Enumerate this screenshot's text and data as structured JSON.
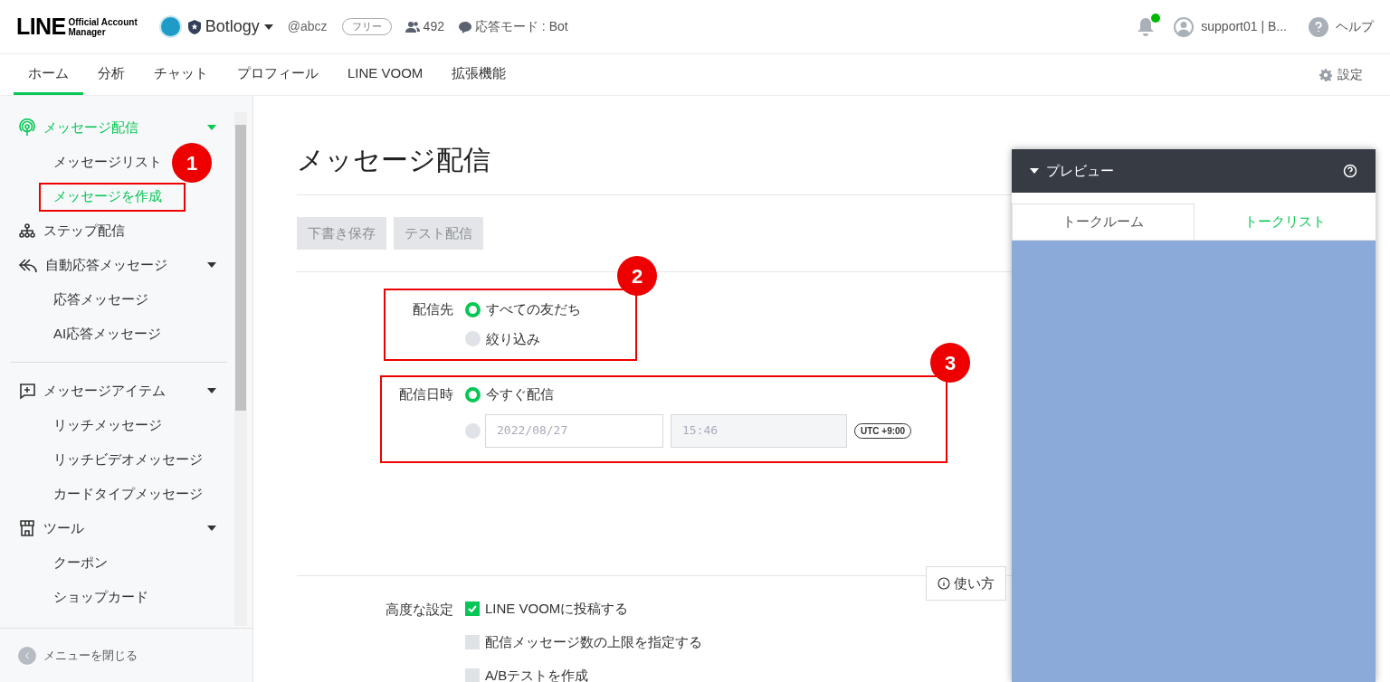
{
  "header": {
    "logo": {
      "wordmark": "LINE",
      "subtitle_1": "Official Account",
      "subtitle_2": "Manager"
    },
    "account": {
      "name": "Botlogy",
      "handle": "@abcz",
      "plan": "フリー",
      "friends": "492",
      "mode": "応答モード : Bot"
    },
    "notifications": {
      "unread": true
    },
    "user": "support01 | B...",
    "help": "ヘルプ"
  },
  "nav": {
    "tabs": [
      {
        "label": "ホーム",
        "selected": true
      },
      {
        "label": "分析",
        "selected": false
      },
      {
        "label": "チャット",
        "selected": false
      },
      {
        "label": "プロフィール",
        "selected": false
      },
      {
        "label": "LINE VOOM",
        "selected": false
      },
      {
        "label": "拡張機能",
        "selected": false
      }
    ],
    "settings": "設定"
  },
  "sidebar": {
    "sections": [
      [
        {
          "label": "メッセージ配信",
          "selected": true,
          "expanded": true,
          "children": [
            {
              "label": "メッセージリスト",
              "selected": false
            },
            {
              "label": "メッセージを作成",
              "selected": true,
              "annotation": "1"
            }
          ]
        },
        {
          "label": "ステップ配信",
          "selected": false
        },
        {
          "label": "自動応答メッセージ",
          "selected": false,
          "expanded": true,
          "children": [
            {
              "label": "応答メッセージ",
              "selected": false
            },
            {
              "label": "AI応答メッセージ",
              "selected": false
            }
          ]
        }
      ],
      [
        {
          "label": "メッセージアイテム",
          "selected": false,
          "expanded": true,
          "children": [
            {
              "label": "リッチメッセージ",
              "selected": false
            },
            {
              "label": "リッチビデオメッセージ",
              "selected": false
            },
            {
              "label": "カードタイプメッセージ",
              "selected": false
            }
          ]
        },
        {
          "label": "ツール",
          "selected": false,
          "expanded": true,
          "children": [
            {
              "label": "クーポン",
              "selected": false
            },
            {
              "label": "ショップカード",
              "selected": false
            }
          ]
        }
      ]
    ],
    "close_menu": "メニューを閉じる"
  },
  "main": {
    "title": "メッセージ配信",
    "buttons": [
      {
        "label": "下書き保存",
        "disabled": true
      },
      {
        "label": "テスト配信",
        "disabled": true
      }
    ],
    "recipients": {
      "label": "配信先",
      "annotation": "2",
      "options": [
        {
          "label": "すべての友だち",
          "selected": true
        },
        {
          "label": "絞り込み",
          "selected": false
        }
      ]
    },
    "schedule": {
      "label": "配信日時",
      "annotation": "3",
      "options": [
        {
          "kind": "text",
          "label": "今すぐ配信",
          "selected": true
        },
        {
          "kind": "datetime",
          "selected": false,
          "date": "2022/08/27",
          "time": "15:46",
          "timezone": "UTC +9:00"
        }
      ]
    },
    "advanced": {
      "label": "高度な設定",
      "help": "使い方",
      "options": [
        {
          "label": "LINE VOOMに投稿する",
          "checked": true
        },
        {
          "label": "配信メッセージ数の上限を指定する",
          "checked": false
        },
        {
          "label": "A/Bテストを作成",
          "checked": false
        }
      ]
    }
  },
  "preview": {
    "title": "プレビュー",
    "expanded": true,
    "tabs": [
      {
        "label": "トークルーム",
        "selected": true
      },
      {
        "label": "トークリスト",
        "selected": false
      }
    ]
  }
}
